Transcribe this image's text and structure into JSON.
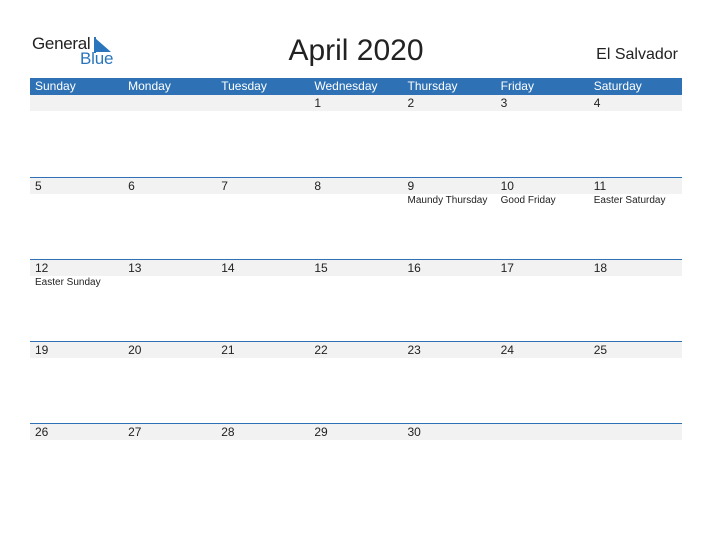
{
  "logo": {
    "line1": "General",
    "line2": "Blue"
  },
  "title": "April 2020",
  "country": "El Salvador",
  "weekdays": [
    "Sunday",
    "Monday",
    "Tuesday",
    "Wednesday",
    "Thursday",
    "Friday",
    "Saturday"
  ],
  "weeks": [
    {
      "days": [
        "",
        "",
        "",
        "1",
        "2",
        "3",
        "4"
      ],
      "events": [
        "",
        "",
        "",
        "",
        "",
        "",
        ""
      ]
    },
    {
      "days": [
        "5",
        "6",
        "7",
        "8",
        "9",
        "10",
        "11"
      ],
      "events": [
        "",
        "",
        "",
        "",
        "Maundy Thursday",
        "Good Friday",
        "Easter Saturday"
      ]
    },
    {
      "days": [
        "12",
        "13",
        "14",
        "15",
        "16",
        "17",
        "18"
      ],
      "events": [
        "Easter Sunday",
        "",
        "",
        "",
        "",
        "",
        ""
      ]
    },
    {
      "days": [
        "19",
        "20",
        "21",
        "22",
        "23",
        "24",
        "25"
      ],
      "events": [
        "",
        "",
        "",
        "",
        "",
        "",
        ""
      ]
    },
    {
      "days": [
        "26",
        "27",
        "28",
        "29",
        "30",
        "",
        ""
      ],
      "events": [
        "",
        "",
        "",
        "",
        "",
        "",
        ""
      ]
    }
  ],
  "colors": {
    "accent": "#2e72b5",
    "logo_blue": "#2a75bb",
    "date_strip": "#f2f2f2"
  }
}
